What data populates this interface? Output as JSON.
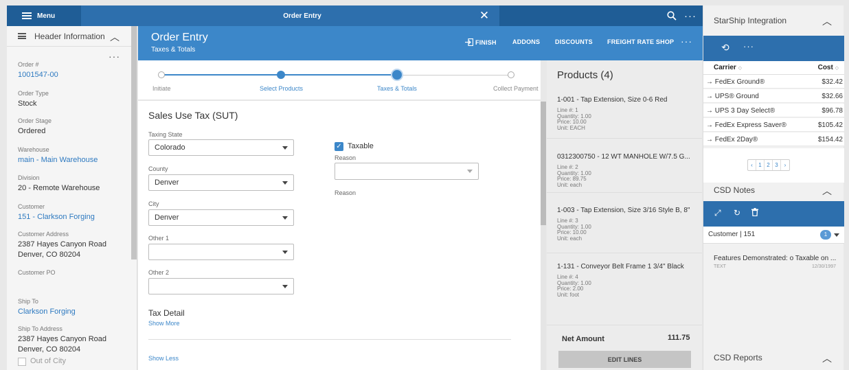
{
  "topbar": {
    "menu_label": "Menu",
    "title": "Order Entry",
    "close_glyph": "✕",
    "more_glyph": "···"
  },
  "header_panel": {
    "title": "Header Information",
    "fields": {
      "order_no_label": "Order #",
      "order_no": "1001547-00",
      "order_type_label": "Order Type",
      "order_type": "Stock",
      "order_stage_label": "Order Stage",
      "order_stage": "Ordered",
      "warehouse_label": "Warehouse",
      "warehouse": "main - Main Warehouse",
      "division_label": "Division",
      "division": "20 - Remote Warehouse",
      "customer_label": "Customer",
      "customer": "151 - Clarkson Forging",
      "customer_address_label": "Customer Address",
      "customer_address_1": "2387 Hayes Canyon Road",
      "customer_address_2": "Denver, CO 80204",
      "customer_po_label": "Customer PO",
      "ship_to_label": "Ship To",
      "ship_to": "Clarkson Forging",
      "ship_to_address_label": "Ship To Address",
      "ship_to_address_1": "2387 Hayes Canyon Road",
      "ship_to_address_2": "Denver, CO 80204",
      "out_of_city_label": "Out of City"
    }
  },
  "main": {
    "title": "Order Entry",
    "subtitle": "Taxes & Totals",
    "actions": {
      "finish": "FINISH",
      "addons": "ADDONS",
      "discounts": "DISCOUNTS",
      "freight": "FREIGHT RATE SHOP"
    },
    "steps": [
      "Initiate",
      "Select Products",
      "Taxes & Totals",
      "Collect Payment"
    ]
  },
  "form": {
    "section_title": "Sales Use Tax (SUT)",
    "taxing_state_label": "Taxing State",
    "taxing_state": "Colorado",
    "county_label": "County",
    "county": "Denver",
    "city_label": "City",
    "city": "Denver",
    "other1_label": "Other 1",
    "other2_label": "Other 2",
    "taxable_label": "Taxable",
    "reason_label": "Reason",
    "tax_detail": "Tax Detail",
    "show_more": "Show More",
    "show_less": "Show Less"
  },
  "products": {
    "title": "Products (4)",
    "items": [
      {
        "name": "1-001 - Tap Extension, Size 0-6 Red",
        "line": "Line #: 1",
        "qty": "Quantity: 1.00",
        "price": "Price: 10.00",
        "unit": "Unit: EACH"
      },
      {
        "name": "0312300750 - 12 WT MANHOLE W/7.5 G...",
        "line": "Line #: 2",
        "qty": "Quantity: 1.00",
        "price": "Price: 89.75",
        "unit": "Unit: each"
      },
      {
        "name": "1-003 - Tap Extension, Size 3/16 Style B, 8\"",
        "line": "Line #: 3",
        "qty": "Quantity: 1.00",
        "price": "Price: 10.00",
        "unit": "Unit: each"
      },
      {
        "name": "1-131 - Conveyor Belt Frame 1 3/4\" Black",
        "line": "Line #: 4",
        "qty": "Quantity: 1.00",
        "price": "Price: 2.00",
        "unit": "Unit: foot"
      }
    ],
    "net_amount_label": "Net Amount",
    "net_amount": "111.75",
    "edit_lines": "EDIT LINES"
  },
  "starship": {
    "title": "StarShip Integration",
    "col_carrier": "Carrier",
    "col_cost": "Cost",
    "rows": [
      {
        "carrier": "→ FedEx Ground®",
        "cost": "$32.42"
      },
      {
        "carrier": "→ UPS® Ground",
        "cost": "$32.66"
      },
      {
        "carrier": "→ UPS 3 Day Select®",
        "cost": "$96.78"
      },
      {
        "carrier": "→ FedEx Express Saver®",
        "cost": "$105.42"
      },
      {
        "carrier": "→ FedEx 2Day®",
        "cost": "$154.42"
      }
    ],
    "pager": [
      "‹",
      "1",
      "2",
      "3",
      "›"
    ]
  },
  "csd_notes": {
    "title": "CSD Notes",
    "filter": "Customer | 151",
    "count": "1",
    "note_title": "Features Demonstrated: o Taxable on ...",
    "note_kind": "TEXT",
    "note_date": "12/30/1997"
  },
  "csd_reports": {
    "title": "CSD Reports"
  },
  "colors": {
    "header_blue": "#3c87c9",
    "dark_blue": "#2d6fad",
    "link": "#2d79c0"
  }
}
